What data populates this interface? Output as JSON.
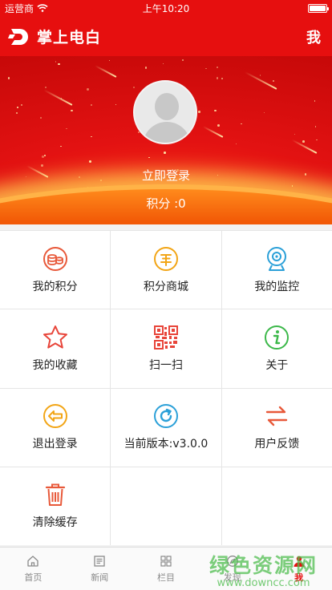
{
  "status_bar": {
    "carrier": "运营商",
    "time": "上午10:20"
  },
  "header": {
    "title": "掌上电白",
    "right_label": "我"
  },
  "profile": {
    "login_label": "立即登录",
    "points_text": "积分 :0"
  },
  "menu": [
    {
      "label": "我的积分",
      "icon": "coin-stack-icon",
      "color": "#e8593a"
    },
    {
      "label": "积分商城",
      "icon": "yuan-icon",
      "color": "#f2a516"
    },
    {
      "label": "我的监控",
      "icon": "webcam-icon",
      "color": "#2ba0d8"
    },
    {
      "label": "我的收藏",
      "icon": "star-icon",
      "color": "#e8453a"
    },
    {
      "label": "扫一扫",
      "icon": "qr-code-icon",
      "color": "#e8453a"
    },
    {
      "label": "关于",
      "icon": "info-icon",
      "color": "#3cb84a"
    },
    {
      "label": "退出登录",
      "icon": "exit-arrow-icon",
      "color": "#f2a516"
    },
    {
      "label": "当前版本:v3.0.0",
      "icon": "refresh-icon",
      "color": "#2ba0d8"
    },
    {
      "label": "用户反馈",
      "icon": "swap-arrows-icon",
      "color": "#e8593a"
    },
    {
      "label": "清除缓存",
      "icon": "trash-icon",
      "color": "#e8593a"
    }
  ],
  "tabbar": {
    "active_color": "#e60f0f",
    "items": [
      {
        "label": "首页",
        "icon": "home-icon"
      },
      {
        "label": "新闻",
        "icon": "news-icon"
      },
      {
        "label": "栏目",
        "icon": "grid-icon"
      },
      {
        "label": "发现",
        "icon": "compass-icon"
      },
      {
        "label": "我",
        "icon": "user-icon"
      }
    ]
  },
  "watermark": {
    "text": "绿色资源网",
    "url": "www.downcc.com"
  }
}
